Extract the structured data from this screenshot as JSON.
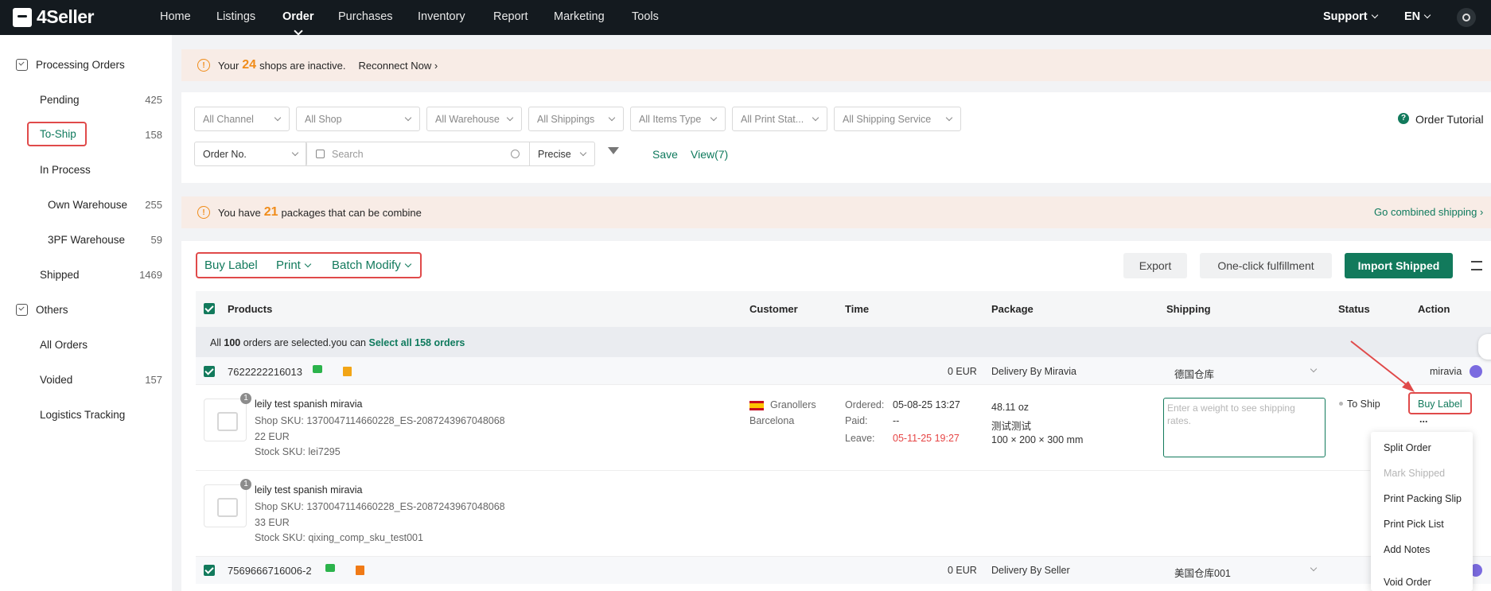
{
  "brand": "4Seller",
  "nav": {
    "items": [
      "Home",
      "Listings",
      "Order",
      "Purchases",
      "Inventory",
      "Report",
      "Marketing",
      "Tools"
    ],
    "support": "Support",
    "lang": "EN"
  },
  "sidebar": {
    "processing_title": "Processing Orders",
    "pending": {
      "label": "Pending",
      "count": "425"
    },
    "to_ship": {
      "label": "To-Ship",
      "count": "158"
    },
    "in_process": "In Process",
    "own_warehouse": {
      "label": "Own Warehouse",
      "count": "255"
    },
    "pf_warehouse": {
      "label": "3PF Warehouse",
      "count": "59"
    },
    "shipped": {
      "label": "Shipped",
      "count": "1469"
    },
    "others_title": "Others",
    "all_orders": "All Orders",
    "voided": {
      "label": "Voided",
      "count": "157"
    },
    "logistics": "Logistics Tracking"
  },
  "banner_inactive": {
    "prefix": "Your",
    "count": "24",
    "suffix": "shops are inactive.",
    "link": "Reconnect Now"
  },
  "filters": {
    "channel": "All Channel",
    "shop": "All Shop",
    "warehouse": "All Warehouse",
    "shippings": "All Shippings",
    "items_type": "All Items Type",
    "print_status": "All Print Stat...",
    "shipping_service": "All Shipping Service",
    "order_no": "Order No.",
    "search_placeholder": "Search",
    "precise": "Precise",
    "save": "Save",
    "view": "View(7)",
    "tutorial": "Order Tutorial"
  },
  "banner_combine": {
    "prefix": "You have",
    "count": "21",
    "suffix": "packages that can be combine",
    "link": "Go combined shipping"
  },
  "toolbar": {
    "buy_label": "Buy Label",
    "print": "Print",
    "batch_modify": "Batch Modify",
    "export": "Export",
    "one_click": "One-click fulfillment",
    "import_shipped": "Import Shipped"
  },
  "table": {
    "headers": {
      "products": "Products",
      "customer": "Customer",
      "time": "Time",
      "package": "Package",
      "shipping": "Shipping",
      "status": "Status",
      "action": "Action"
    },
    "selection": {
      "prefix": "All",
      "count": "100",
      "middle": "orders are selected.you can",
      "link": "Select all 158 orders"
    }
  },
  "order1": {
    "id": "7622222216013",
    "amount": "0 EUR",
    "delivery": "Delivery By Miravia",
    "warehouse": "德国仓库",
    "platform": "miravia",
    "item1": {
      "qty": "1",
      "name": "leily test spanish miravia",
      "shop_sku": "Shop SKU: 1370047114660228_ES-2087243967048068",
      "price": "22 EUR",
      "stock_sku": "Stock SKU: lei7295"
    },
    "item2": {
      "qty": "1",
      "name": "leily test spanish miravia",
      "shop_sku": "Shop SKU: 1370047114660228_ES-2087243967048068",
      "price": "33 EUR",
      "stock_sku": "Stock SKU: qixing_comp_sku_test001"
    },
    "customer_city": "Granollers",
    "customer_region": "Barcelona",
    "ordered_label": "Ordered:",
    "ordered": "05-08-25 13:27",
    "paid_label": "Paid:",
    "paid": "--",
    "leave_label": "Leave:",
    "leave": "05-11-25 19:27",
    "weight": "48.11 oz",
    "package_note": "测试测试",
    "dims": "100 × 200 × 300 mm",
    "weight_placeholder": "Enter a weight to see shipping rates.",
    "status": "To Ship",
    "action": "Buy Label",
    "more": "..."
  },
  "order2": {
    "id": "7569666716006-2",
    "amount": "0 EUR",
    "delivery": "Delivery By Seller",
    "warehouse": "美国仓库001"
  },
  "menu": [
    "Split Order",
    "Mark Shipped",
    "Print Packing Slip",
    "Print Pick List",
    "Add Notes",
    "Void Order"
  ],
  "colors": {
    "accent": "#127a5c",
    "highlight": "#e04a4a",
    "warning": "#f08c1a"
  }
}
